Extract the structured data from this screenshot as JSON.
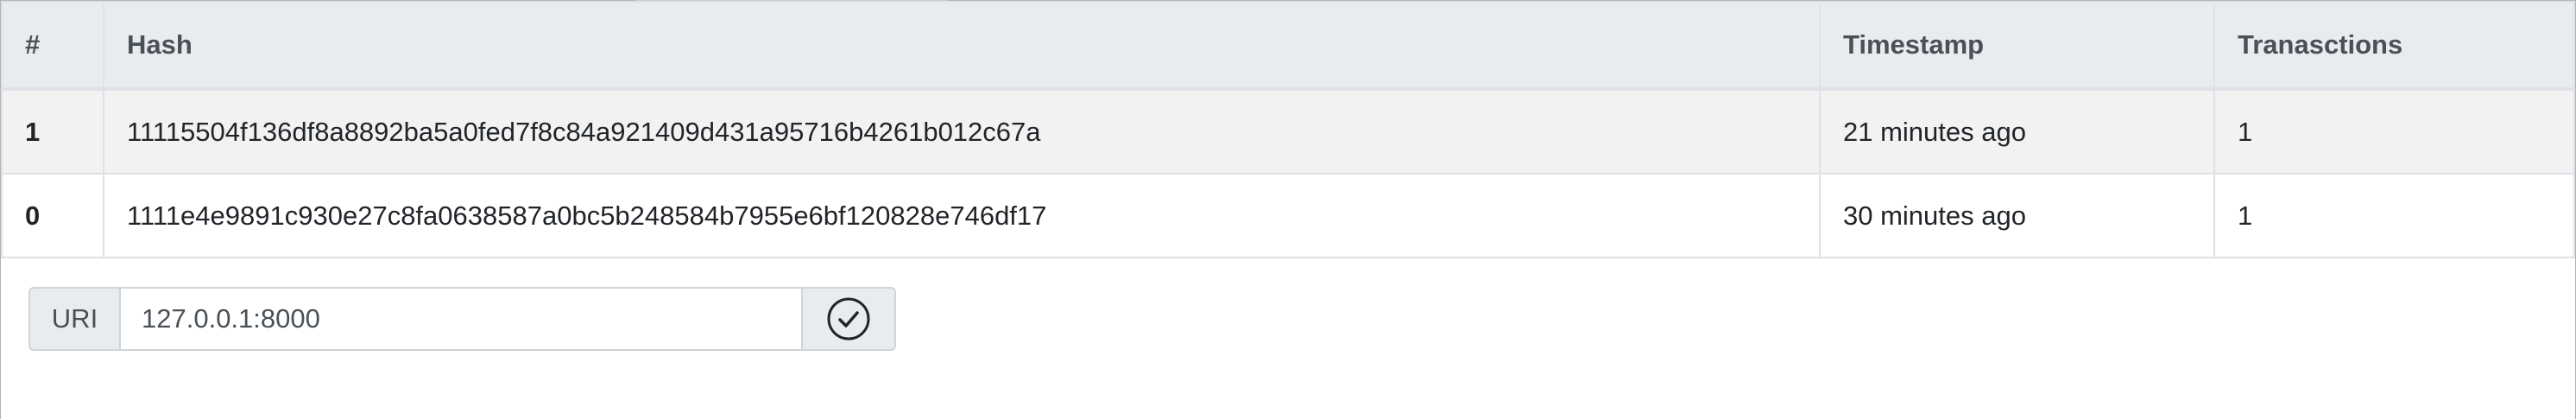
{
  "table": {
    "headers": {
      "number": "#",
      "hash": "Hash",
      "timestamp": "Timestamp",
      "transactions": "Tranasctions"
    },
    "rows": [
      {
        "number": "1",
        "hash": "11115504f136df8a8892ba5a0fed7f8c84a921409d431a95716b4261b012c67a",
        "timestamp": "21 minutes ago",
        "transactions": "1"
      },
      {
        "number": "0",
        "hash": "1111e4e9891c930e27c8fa0638587a0bc5b248584b7955e6bf120828e746df17",
        "timestamp": "30 minutes ago",
        "transactions": "1"
      }
    ]
  },
  "uri_form": {
    "label": "URI",
    "value": "127.0.0.1:8000",
    "submit_icon": "check-circle-icon"
  }
}
